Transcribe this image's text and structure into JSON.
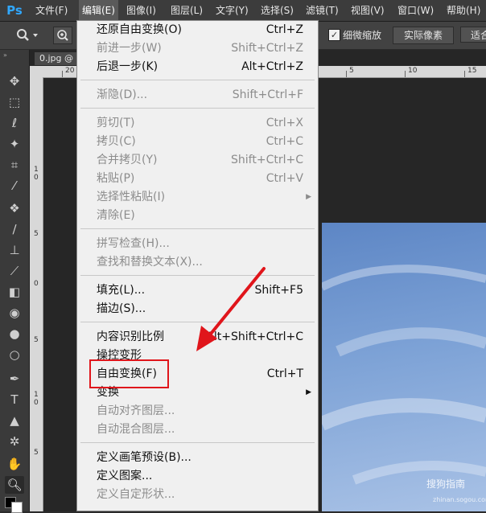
{
  "app": {
    "logo": "Ps"
  },
  "menubar": {
    "items": [
      {
        "label": "文件(F)"
      },
      {
        "label": "编辑(E)"
      },
      {
        "label": "图像(I)"
      },
      {
        "label": "图层(L)"
      },
      {
        "label": "文字(Y)"
      },
      {
        "label": "选择(S)"
      },
      {
        "label": "滤镜(T)"
      },
      {
        "label": "视图(V)"
      },
      {
        "label": "窗口(W)"
      },
      {
        "label": "帮助(H)"
      }
    ]
  },
  "optionsbar": {
    "checkbox_label": "细微缩放",
    "actual_pixels": "实际像素",
    "fit_button": "适合"
  },
  "document": {
    "tab_title": "0.jpg @",
    "ruler_top": [
      "20",
      "5",
      "10",
      "15"
    ],
    "ruler_left": [
      "1",
      "0",
      "5",
      "0",
      "5",
      "1",
      "0",
      "5"
    ]
  },
  "edit_menu": {
    "items": [
      {
        "label": "还原自由变换(O)",
        "shortcut": "Ctrl+Z"
      },
      {
        "label": "前进一步(W)",
        "shortcut": "Shift+Ctrl+Z"
      },
      {
        "label": "后退一步(K)",
        "shortcut": "Alt+Ctrl+Z"
      },
      {
        "label": "渐隐(D)...",
        "shortcut": "Shift+Ctrl+F"
      },
      {
        "label": "剪切(T)",
        "shortcut": "Ctrl+X"
      },
      {
        "label": "拷贝(C)",
        "shortcut": "Ctrl+C"
      },
      {
        "label": "合并拷贝(Y)",
        "shortcut": "Shift+Ctrl+C"
      },
      {
        "label": "粘贴(P)",
        "shortcut": "Ctrl+V"
      },
      {
        "label": "选择性粘贴(I)",
        "shortcut": ""
      },
      {
        "label": "清除(E)",
        "shortcut": ""
      },
      {
        "label": "拼写检查(H)...",
        "shortcut": ""
      },
      {
        "label": "查找和替换文本(X)...",
        "shortcut": ""
      },
      {
        "label": "填充(L)...",
        "shortcut": "Shift+F5"
      },
      {
        "label": "描边(S)...",
        "shortcut": ""
      },
      {
        "label": "内容识别比例",
        "shortcut": "Alt+Shift+Ctrl+C"
      },
      {
        "label": "操控变形",
        "shortcut": ""
      },
      {
        "label": "自由变换(F)",
        "shortcut": "Ctrl+T"
      },
      {
        "label": "变换",
        "shortcut": ""
      },
      {
        "label": "自动对齐图层...",
        "shortcut": ""
      },
      {
        "label": "自动混合图层...",
        "shortcut": ""
      },
      {
        "label": "定义画笔预设(B)...",
        "shortcut": ""
      },
      {
        "label": "定义图案...",
        "shortcut": ""
      },
      {
        "label": "定义自定形状...",
        "shortcut": ""
      }
    ]
  },
  "watermark": {
    "line1": "搜狗指南",
    "line2": "zhinan.sogou.com"
  },
  "colors": {
    "accent_red": "#e0151b",
    "menu_bg": "#f0f0f0",
    "ps_blue": "#31a8ff"
  }
}
